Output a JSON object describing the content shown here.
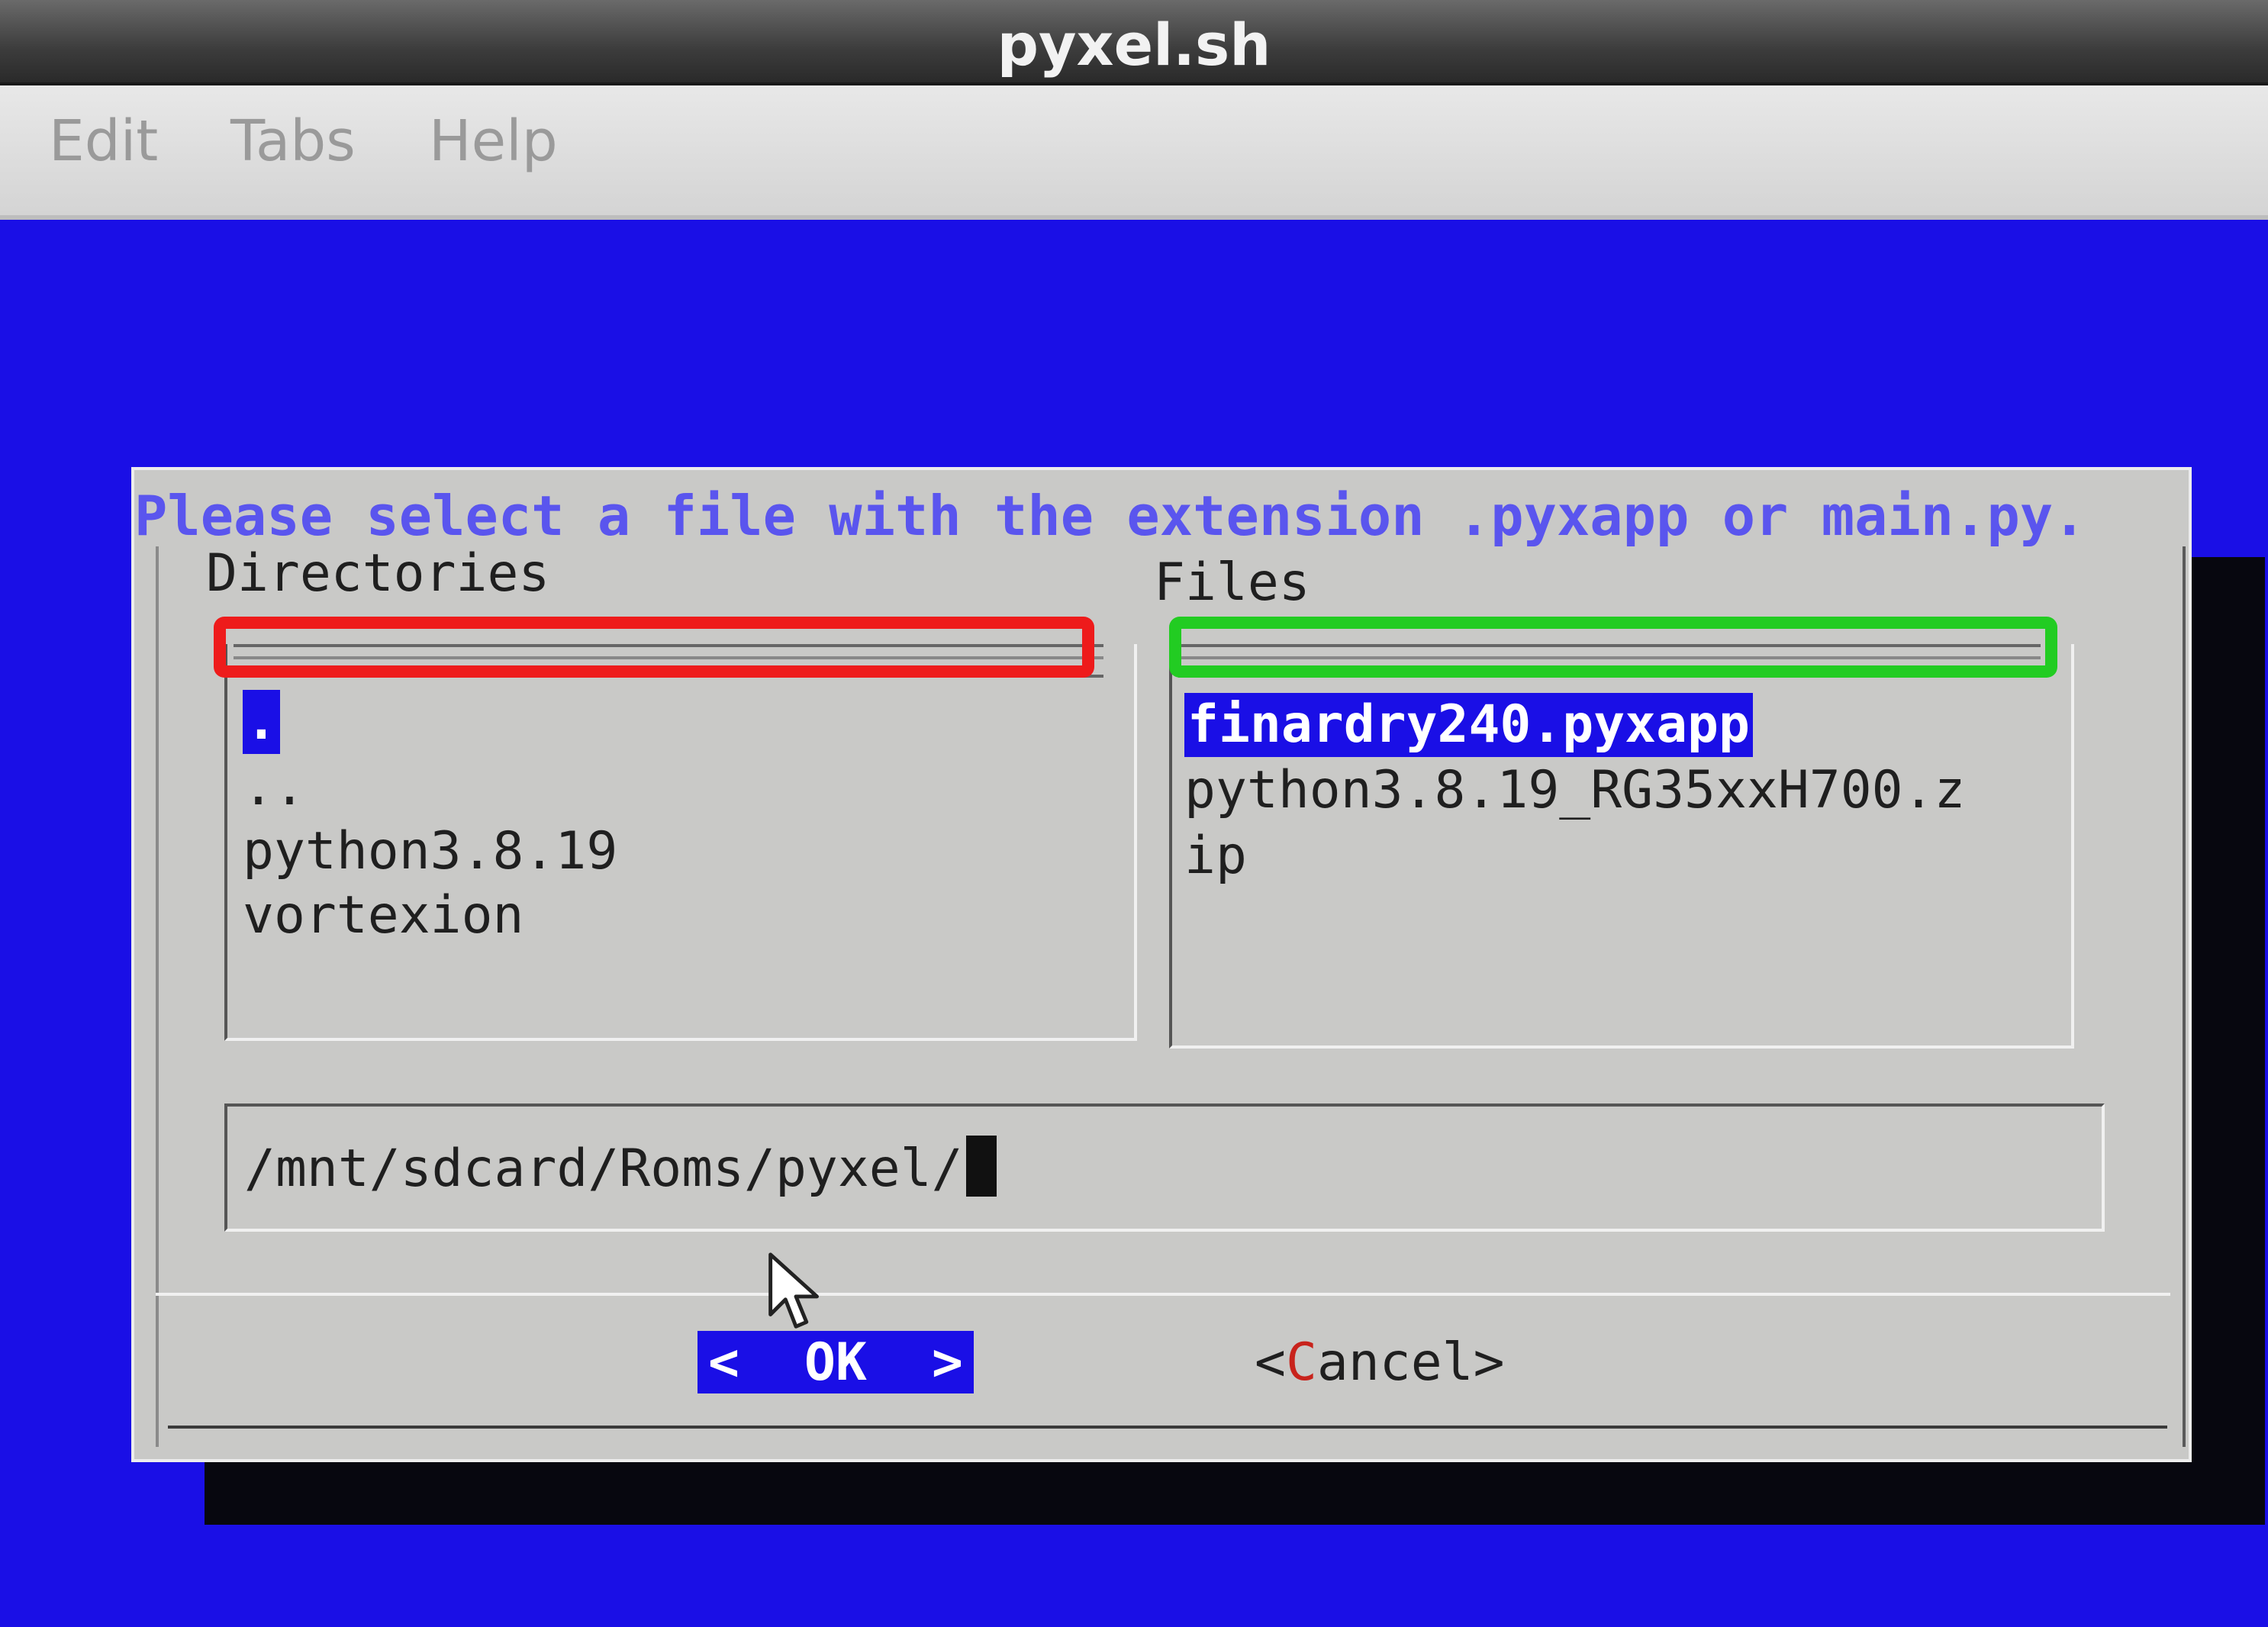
{
  "window": {
    "title": "pyxel.sh"
  },
  "menubar": {
    "items": [
      "Edit",
      "Tabs",
      "Help"
    ]
  },
  "dialog": {
    "title": "Please select a file with the extension .pyxapp or main.py.",
    "directories": {
      "label": "Directories",
      "entries": [
        ".",
        "..",
        "python3.8.19",
        "vortexion"
      ],
      "selected_index": 0
    },
    "files": {
      "label": "Files",
      "entries": [
        "finardry240.pyxapp",
        "python3.8.19_RG35xxH700.z",
        "ip"
      ],
      "selected_index": 0
    },
    "path_input": {
      "value": "/mnt/sdcard/Roms/pyxel/"
    },
    "buttons": {
      "ok": {
        "left": "<",
        "label": "OK",
        "right": ">"
      },
      "cancel": {
        "open": "<",
        "hotkey": "C",
        "rest": "ancel",
        "close": ">"
      }
    }
  },
  "colors": {
    "background": "#1a0fe6",
    "dialog": "#c9c9c7",
    "title_text": "#5a55ee",
    "highlight_directories": "#ee1b1b",
    "highlight_files": "#22cc22",
    "cancel_hotkey": "#c8231c"
  }
}
